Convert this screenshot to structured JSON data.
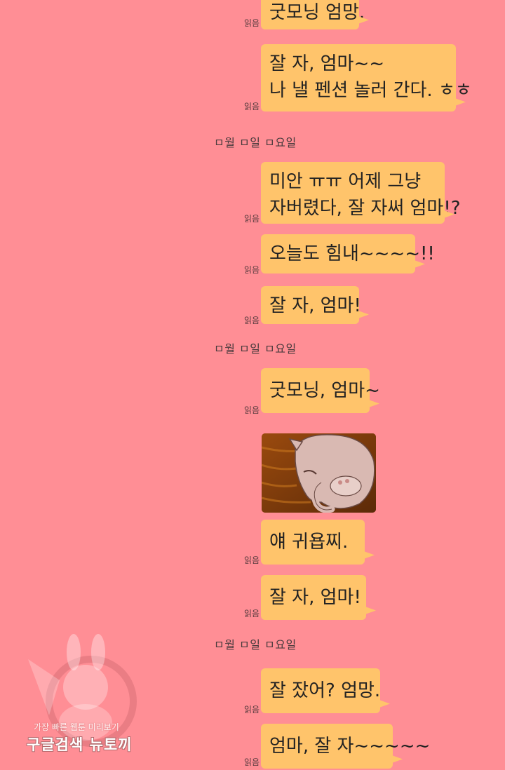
{
  "messages": [
    {
      "read": "읽음",
      "lines": [
        "굿모닝 엄망."
      ]
    },
    {
      "read": "읽음",
      "lines": [
        "잘 자, 엄마~~",
        "나 낼 펜션 놀러 간다. ㅎㅎ"
      ]
    },
    {
      "read": "읽음",
      "lines": [
        "미안 ㅠㅠ 어제 그냥",
        "자버렸다, 잘 자써 엄마!?"
      ]
    },
    {
      "read": "읽음",
      "lines": [
        "오늘도 힘내~~~~!!"
      ]
    },
    {
      "read": "읽음",
      "lines": [
        "잘 자, 엄마!"
      ]
    },
    {
      "read": "읽음",
      "lines": [
        "굿모닝, 엄마~"
      ]
    },
    {
      "read": "읽음",
      "lines": [
        "얘 귀욥찌."
      ]
    },
    {
      "read": "읽음",
      "lines": [
        "잘 자, 엄마!"
      ]
    },
    {
      "read": "읽음",
      "lines": [
        "잘 잤어? 엄망."
      ]
    },
    {
      "read": "읽음",
      "lines": [
        "엄마, 잘 자~~~~~"
      ]
    }
  ],
  "dates": [
    "ㅁ월 ㅁ일 ㅁ요일",
    "ㅁ월 ㅁ일 ㅁ요일",
    "ㅁ월 ㅁ일 ㅁ요일"
  ],
  "photo": {
    "icon": "sleeping-cat-image"
  },
  "watermark": {
    "line1": "가장 빠른 웹툰 미리보기",
    "line2": "구글검색 뉴토끼"
  },
  "colors": {
    "background": "#ff8e95",
    "bubble": "#ffc46b"
  }
}
